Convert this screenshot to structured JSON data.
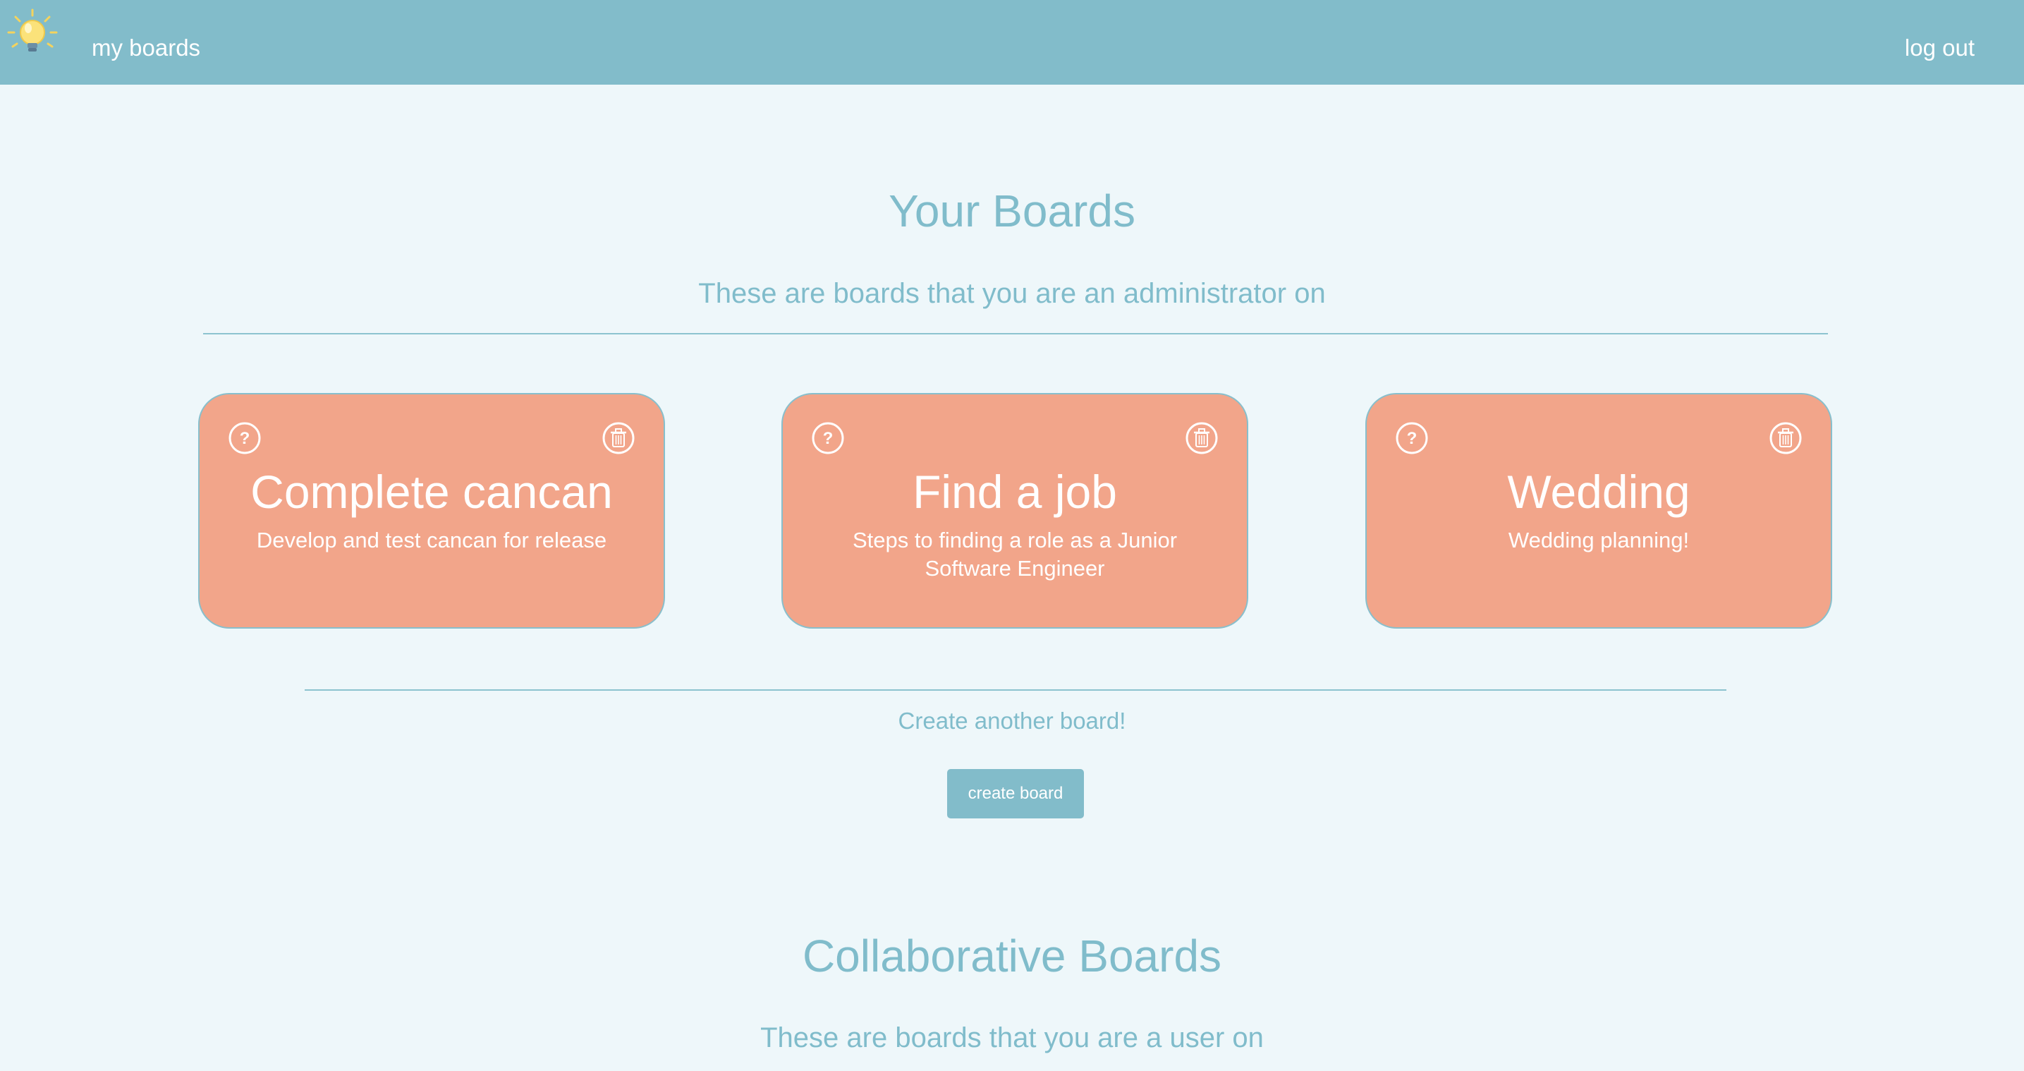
{
  "nav": {
    "my_boards": "my boards",
    "log_out": "log out"
  },
  "your_boards": {
    "title": "Your Boards",
    "subtitle": "These are boards that you are an administrator on",
    "boards": [
      {
        "title": "Complete cancan",
        "description": "Develop and test cancan for release"
      },
      {
        "title": "Find a job",
        "description": "Steps to finding a role as a Junior Software Engineer"
      },
      {
        "title": "Wedding",
        "description": "Wedding planning!"
      }
    ]
  },
  "create": {
    "prompt": "Create another board!",
    "button_label": "create board"
  },
  "collaborative_boards": {
    "title": "Collaborative Boards",
    "subtitle": "These are boards that you are a user on"
  },
  "icons": {
    "logo": "lightbulb-icon",
    "help": "question-circle-icon",
    "delete": "trash-icon"
  },
  "colors": {
    "navbar": "#82bcca",
    "background": "#eef7fa",
    "card": "#f2a58a",
    "accent_text": "#80bccb"
  }
}
